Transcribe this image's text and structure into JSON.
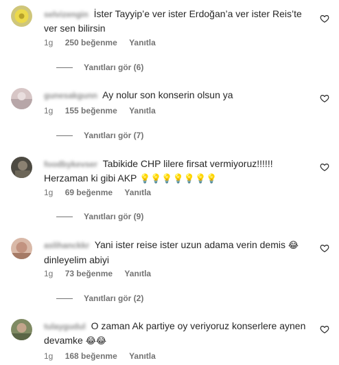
{
  "comments": [
    {
      "username": "selvizengin",
      "text": "İster Tayyip’e ver ister Erdoğan’a ver ister Reis’te ver sen bilirsin",
      "emoji": "",
      "time": "1g",
      "likes": "250 beğenme",
      "reply": "Yanıtla",
      "view_replies": "Yanıtları gör (6)",
      "avatar_color": "#e8d84a"
    },
    {
      "username": "gunesakgunn",
      "text": "Ay nolur son konserin olsun ya",
      "emoji": "",
      "time": "1g",
      "likes": "155 beğenme",
      "reply": "Yanıtla",
      "view_replies": "Yanıtları gör (7)",
      "avatar_color": "#c8b0b0"
    },
    {
      "username": "foodbykevser",
      "text": "Tabikide CHP lilere firsat vermiyoruz!!!!!! Herzaman ki gibi AKP",
      "emoji": "💡💡💡💡💡💡💡",
      "time": "1g",
      "likes": "69 beğenme",
      "reply": "Yanıtla",
      "view_replies": "Yanıtları gör (9)",
      "avatar_color": "#6a6458"
    },
    {
      "username": "aslihanckkr",
      "text": "Yani ister reise ister uzun adama verin demis",
      "emoji": "😂",
      "text2": "dinleyelim abiyi",
      "time": "1g",
      "likes": "73 beğenme",
      "reply": "Yanıtla",
      "view_replies": "Yanıtları gör (2)",
      "avatar_color": "#c9a38f"
    },
    {
      "username": "tulaygudul",
      "text": "O zaman Ak partiye oy veriyoruz konserlere aynen devamke",
      "emoji": "😂😂",
      "time": "1g",
      "likes": "168 beğenme",
      "reply": "Yanıtla",
      "view_replies": "",
      "avatar_color": "#6f7a58"
    }
  ]
}
